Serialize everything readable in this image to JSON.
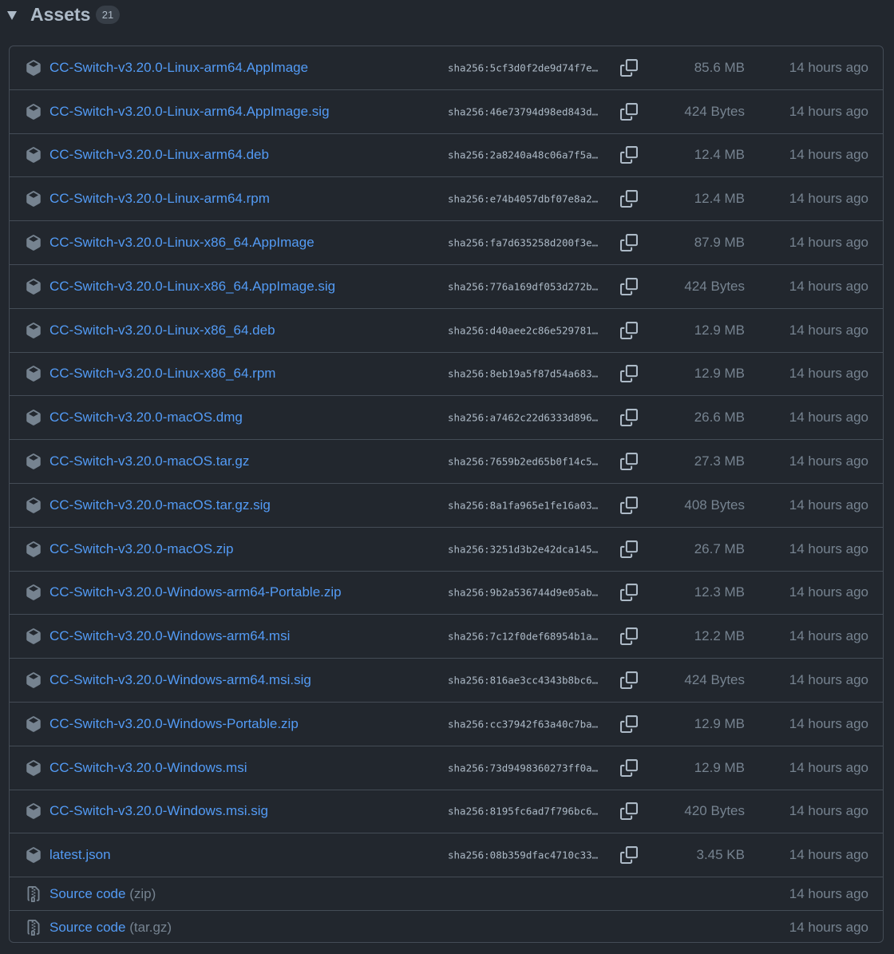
{
  "header": {
    "title": "Assets",
    "count": "21"
  },
  "colors": {
    "background": "#22272e",
    "link": "#539bf5",
    "muted": "#768390",
    "border": "#444c56"
  },
  "assets": [
    {
      "name": "CC-Switch-v3.20.0-Linux-arm64.AppImage",
      "sha": "sha256:5cf3d0f2de9d74f7e…",
      "size": "85.6 MB",
      "time": "14 hours ago"
    },
    {
      "name": "CC-Switch-v3.20.0-Linux-arm64.AppImage.sig",
      "sha": "sha256:46e73794d98ed843d…",
      "size": "424 Bytes",
      "time": "14 hours ago"
    },
    {
      "name": "CC-Switch-v3.20.0-Linux-arm64.deb",
      "sha": "sha256:2a8240a48c06a7f5a…",
      "size": "12.4 MB",
      "time": "14 hours ago"
    },
    {
      "name": "CC-Switch-v3.20.0-Linux-arm64.rpm",
      "sha": "sha256:e74b4057dbf07e8a2…",
      "size": "12.4 MB",
      "time": "14 hours ago"
    },
    {
      "name": "CC-Switch-v3.20.0-Linux-x86_64.AppImage",
      "sha": "sha256:fa7d635258d200f3e…",
      "size": "87.9 MB",
      "time": "14 hours ago"
    },
    {
      "name": "CC-Switch-v3.20.0-Linux-x86_64.AppImage.sig",
      "sha": "sha256:776a169df053d272b…",
      "size": "424 Bytes",
      "time": "14 hours ago"
    },
    {
      "name": "CC-Switch-v3.20.0-Linux-x86_64.deb",
      "sha": "sha256:d40aee2c86e529781…",
      "size": "12.9 MB",
      "time": "14 hours ago"
    },
    {
      "name": "CC-Switch-v3.20.0-Linux-x86_64.rpm",
      "sha": "sha256:8eb19a5f87d54a683…",
      "size": "12.9 MB",
      "time": "14 hours ago"
    },
    {
      "name": "CC-Switch-v3.20.0-macOS.dmg",
      "sha": "sha256:a7462c22d6333d896…",
      "size": "26.6 MB",
      "time": "14 hours ago"
    },
    {
      "name": "CC-Switch-v3.20.0-macOS.tar.gz",
      "sha": "sha256:7659b2ed65b0f14c5…",
      "size": "27.3 MB",
      "time": "14 hours ago"
    },
    {
      "name": "CC-Switch-v3.20.0-macOS.tar.gz.sig",
      "sha": "sha256:8a1fa965e1fe16a03…",
      "size": "408 Bytes",
      "time": "14 hours ago"
    },
    {
      "name": "CC-Switch-v3.20.0-macOS.zip",
      "sha": "sha256:3251d3b2e42dca145…",
      "size": "26.7 MB",
      "time": "14 hours ago"
    },
    {
      "name": "CC-Switch-v3.20.0-Windows-arm64-Portable.zip",
      "sha": "sha256:9b2a536744d9e05ab…",
      "size": "12.3 MB",
      "time": "14 hours ago"
    },
    {
      "name": "CC-Switch-v3.20.0-Windows-arm64.msi",
      "sha": "sha256:7c12f0def68954b1a…",
      "size": "12.2 MB",
      "time": "14 hours ago"
    },
    {
      "name": "CC-Switch-v3.20.0-Windows-arm64.msi.sig",
      "sha": "sha256:816ae3cc4343b8bc6…",
      "size": "424 Bytes",
      "time": "14 hours ago"
    },
    {
      "name": "CC-Switch-v3.20.0-Windows-Portable.zip",
      "sha": "sha256:cc37942f63a40c7ba…",
      "size": "12.9 MB",
      "time": "14 hours ago"
    },
    {
      "name": "CC-Switch-v3.20.0-Windows.msi",
      "sha": "sha256:73d9498360273ff0a…",
      "size": "12.9 MB",
      "time": "14 hours ago"
    },
    {
      "name": "CC-Switch-v3.20.0-Windows.msi.sig",
      "sha": "sha256:8195fc6ad7f796bc6…",
      "size": "420 Bytes",
      "time": "14 hours ago"
    },
    {
      "name": "latest.json",
      "sha": "sha256:08b359dfac4710c33…",
      "size": "3.45 KB",
      "time": "14 hours ago"
    }
  ],
  "source": [
    {
      "label": "Source code",
      "suffix": "(zip)",
      "time": "14 hours ago"
    },
    {
      "label": "Source code",
      "suffix": "(tar.gz)",
      "time": "14 hours ago"
    }
  ],
  "icons": {
    "asset": "package-icon",
    "copy": "copy-icon",
    "source": "file-zip-icon",
    "toggle": "triangle-down-icon"
  }
}
